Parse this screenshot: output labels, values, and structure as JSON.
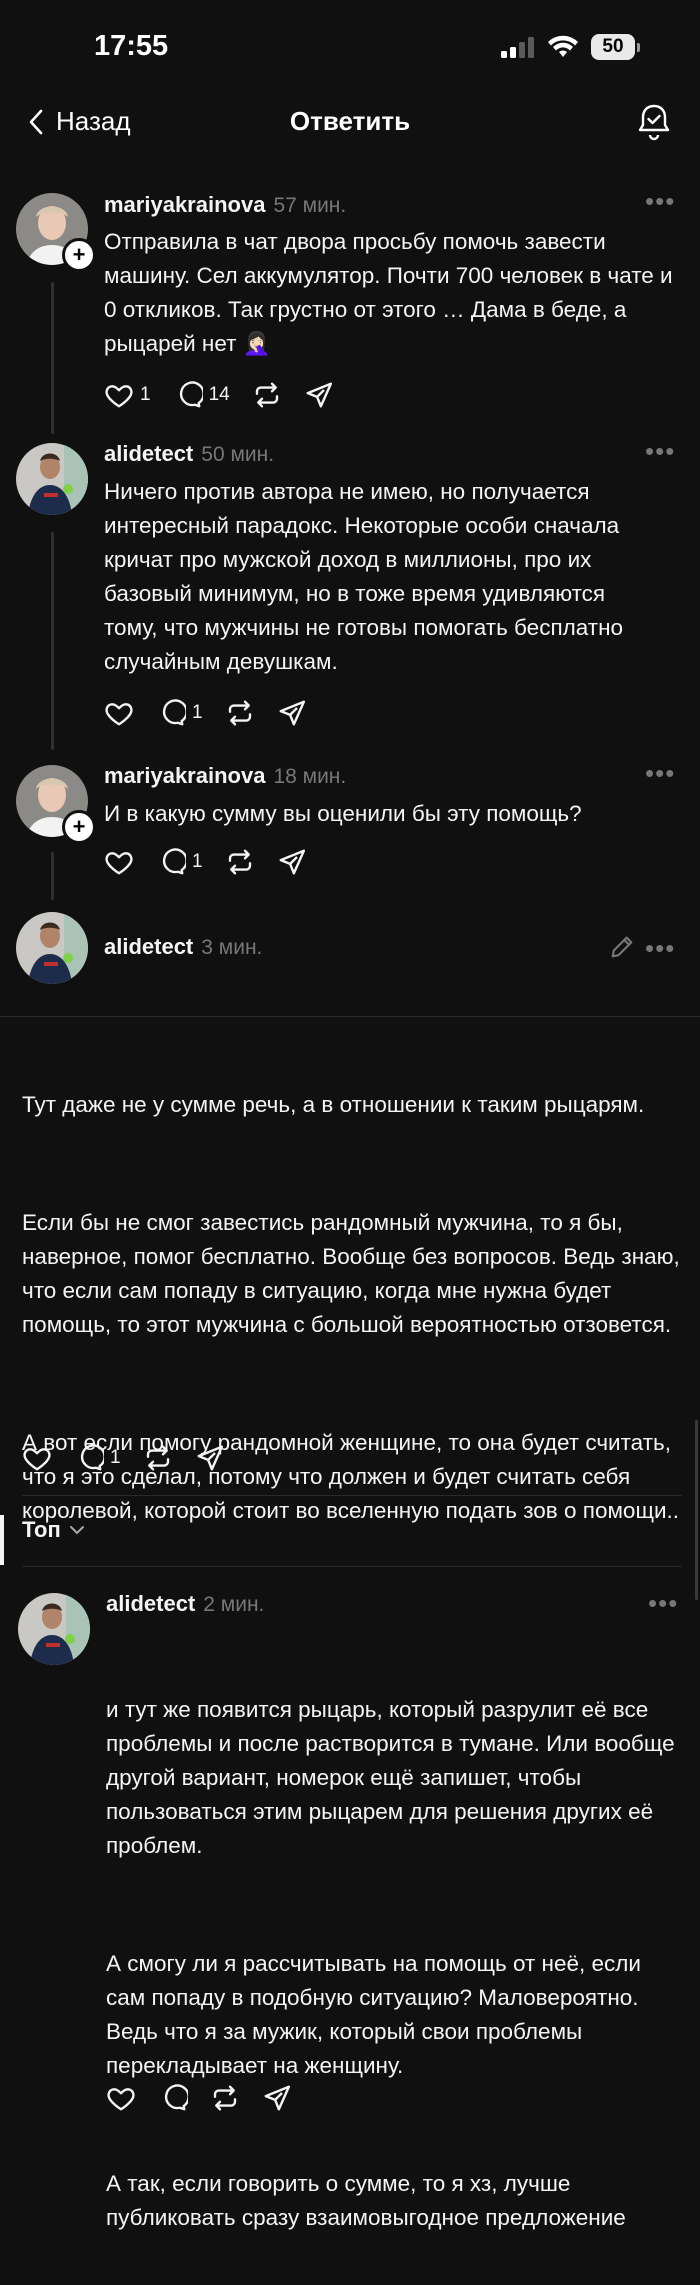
{
  "status_bar": {
    "time": "17:55",
    "battery": "50"
  },
  "nav": {
    "back_label": "Назад",
    "title": "Ответить"
  },
  "thread": [
    {
      "username": "mariyakrainova",
      "time": "57 мин.",
      "text": "Отправила в чат двора просьбу помочь завести машину. Сел аккумулятор. Почти 700 человек в чате и 0 откликов. Так грустно от этого … Дама в беде, а рыцарей нет 🤦🏻‍♀️",
      "likes": "1",
      "replies": "14"
    },
    {
      "username": "alidetect",
      "time": "50 мин.",
      "text": "Ничего против автора не имею, но получается интересный парадокс. Некоторые особи сначала кричат про мужской доход в миллионы, про их базовый минимум, но в тоже время удивляются тому, что мужчины не готовы помогать бесплатно случайным девушкам.",
      "replies": "1"
    },
    {
      "username": "mariyakrainova",
      "time": "18 мин.",
      "text": "И в какую сумму вы оценили бы эту помощь?",
      "replies": "1"
    }
  ],
  "main_post": {
    "username": "alidetect",
    "time": "3 мин.",
    "paragraphs": [
      "Тут даже не у сумме речь, а в отношении к таким рыцарям.",
      "Если бы не смог завестись рандомный мужчина, то я бы, наверное, помог бесплатно. Вообще без вопросов. Ведь знаю, что если сам попаду в ситуацию, когда мне нужна будет помощь, то этот мужчина с большой вероятностью отзовется.",
      "А вот если помогу рандомной женщине, то она будет считать, что я это сделал, потому что должен и будет считать себя королевой, которой стоит во вселенную подать зов о помощи.."
    ],
    "replies": "1"
  },
  "sort": {
    "label": "Топ"
  },
  "reply": {
    "username": "alidetect",
    "time": "2 мин.",
    "paragraphs": [
      "и тут же появится рыцарь, который разрулит её все проблемы и после растворится в тумане. Или вообще другой вариант, номерок ещё запишет, чтобы пользоваться этим рыцарем для решения других её проблем.",
      "А смогу ли я рассчитывать на помощь от неё, если сам попаду в подобную ситуацию? Маловероятно. Ведь что я за мужик, который свои проблемы перекладывает на женщину.",
      "А так, если говорить о сумме, то я хз, лучше публиковать сразу взаимовыгодное предложение"
    ]
  }
}
